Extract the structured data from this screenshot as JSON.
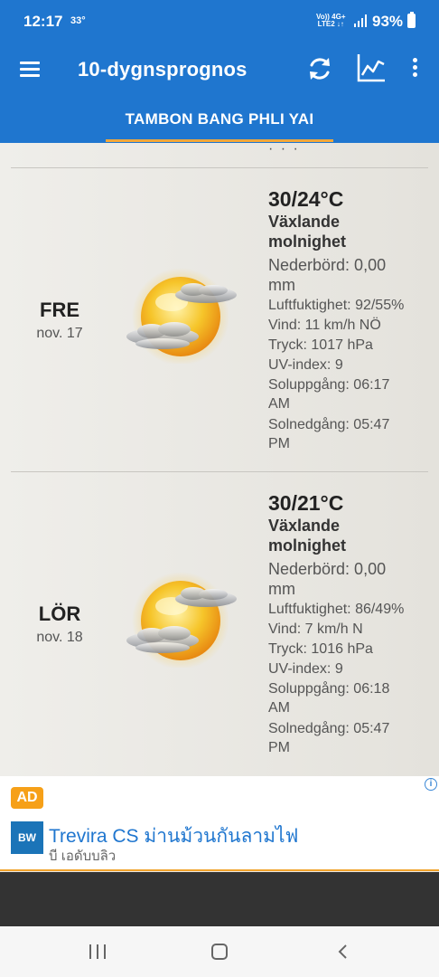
{
  "status_bar": {
    "time": "12:17",
    "temperature": "33°",
    "network_top": "Vo))  4G+",
    "network_bottom": "LTE2  ↓↑",
    "battery": "93%"
  },
  "app_bar": {
    "title": "10-dygnsprognos",
    "location_tab": "TAMBON BANG PHLI YAI",
    "accent_color": "#1f76cf",
    "indicator_color": "#f2a73a",
    "icons": [
      "menu-icon",
      "refresh-icon",
      "chart-icon",
      "more-options-icon"
    ]
  },
  "forecast": {
    "cut_off_text": "· · ·",
    "days": [
      {
        "day": "FRE",
        "date": "nov. 17",
        "icon": "partly-cloudy-icon",
        "temp": "30/24°C",
        "condition_line1": "Växlande",
        "condition_line2": "molnighet",
        "precipitation_line1": "Nederbörd: 0,00",
        "precipitation_line2": "mm",
        "humidity": "Luftfuktighet: 92/55%",
        "wind": "Vind: 11 km/h NÖ",
        "pressure": "Tryck: 1017 hPa",
        "uv": "UV-index: 9",
        "sunrise_line1": "Soluppgång:  06:17",
        "sunrise_line2": "AM",
        "sunset_line1": "Solnedgång:  05:47",
        "sunset_line2": "PM"
      },
      {
        "day": "LÖR",
        "date": "nov. 18",
        "icon": "partly-cloudy-icon",
        "temp": "30/21°C",
        "condition_line1": "Växlande",
        "condition_line2": "molnighet",
        "precipitation_line1": "Nederbörd: 0,00",
        "precipitation_line2": "mm",
        "humidity": "Luftfuktighet: 86/49%",
        "wind": "Vind: 7 km/h N",
        "pressure": "Tryck: 1016 hPa",
        "uv": "UV-index: 9",
        "sunrise_line1": "Soluppgång:  06:18",
        "sunrise_line2": "AM",
        "sunset_line1": "Solnedgång:  05:47",
        "sunset_line2": "PM"
      }
    ]
  },
  "ad": {
    "badge": "AD",
    "info": "i",
    "logo_text": "BW",
    "headline": "Trevira CS ม่านม้วนกันลามไฟ",
    "subtext": "บี เอดับบลิว",
    "badge_color": "#f6a018"
  },
  "nav_bar": {
    "icons": [
      "recent-apps-icon",
      "home-icon",
      "back-icon"
    ]
  }
}
